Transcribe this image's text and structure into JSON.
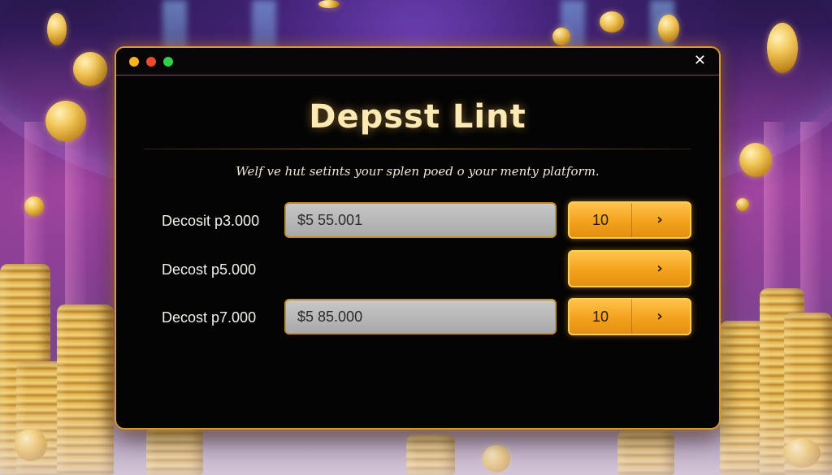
{
  "window": {
    "title": "Depsst Lint",
    "subtitle": "Welf ve hut setints your splen poed o your menty platform.",
    "close_glyph": "✕",
    "traffic_lights": [
      "#f5b31d",
      "#ea4b2c",
      "#2fd14a"
    ]
  },
  "rows": [
    {
      "label": "Decosit p3.000",
      "input_value": "$5 55.001",
      "button_value": "10",
      "chevron": "›"
    },
    {
      "label": "Decost p5.000",
      "input_value": null,
      "button_value": "",
      "chevron": "›"
    },
    {
      "label": "Decost p7.000",
      "input_value": "$5 85.000",
      "button_value": "10",
      "chevron": "›"
    }
  ],
  "colors": {
    "accent_gold": "#d79a2b",
    "button_gold": "#f3a21c",
    "title_cream": "#fde9b4",
    "window_bg": "#050404"
  },
  "icons": [
    "close-icon",
    "chevron-right-icon"
  ]
}
